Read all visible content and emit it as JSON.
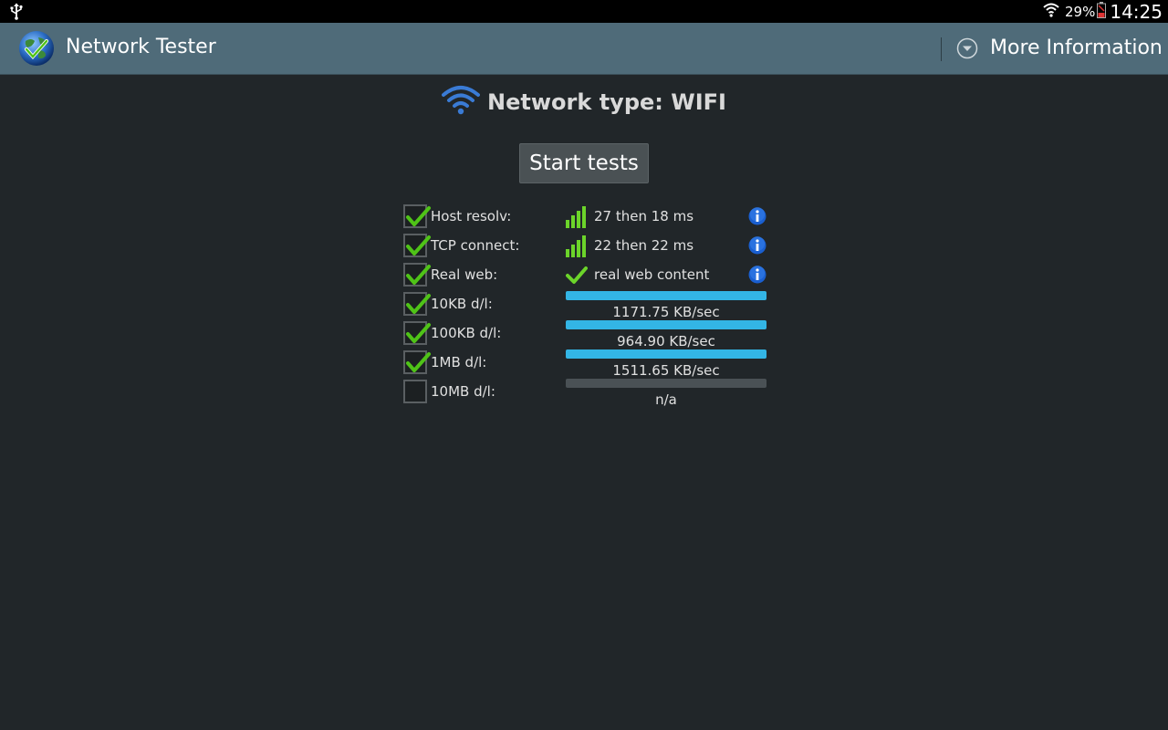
{
  "status_bar": {
    "battery": "29%",
    "time": "14:25",
    "icons": [
      "usb-icon",
      "wifi-icon",
      "battery-icon"
    ]
  },
  "action_bar": {
    "title": "Network Tester",
    "more_info": "More Information",
    "icons": [
      "globe-check-icon",
      "chevron-down-circle-icon"
    ]
  },
  "network": {
    "label": "Network type: WIFI",
    "icon": "wifi-icon",
    "accent": "#3a7bd5"
  },
  "start_button": "Start tests",
  "tests": [
    {
      "label": "Host resolv:",
      "checked": true,
      "result": "27 then 18 ms",
      "icon": "signal-bars-icon",
      "info": true
    },
    {
      "label": "TCP connect:",
      "checked": true,
      "result": "22 then 22 ms",
      "icon": "signal-bars-icon",
      "info": true
    },
    {
      "label": "Real web:",
      "checked": true,
      "result": "real web content",
      "icon": "check-icon",
      "info": true
    }
  ],
  "downloads": [
    {
      "label": "10KB d/l:",
      "checked": true,
      "speed": "1171.75 KB/sec",
      "progress": 1.0
    },
    {
      "label": "100KB d/l:",
      "checked": true,
      "speed": "964.90 KB/sec",
      "progress": 1.0
    },
    {
      "label": "1MB d/l:",
      "checked": true,
      "speed": "1511.65 KB/sec",
      "progress": 1.0
    },
    {
      "label": "10MB d/l:",
      "checked": false,
      "speed": "n/a",
      "progress": 0.0
    }
  ],
  "colors": {
    "background": "#212629",
    "action_bar": "#4f6b79",
    "progress": "#33b5e5",
    "check": "#4fc317",
    "info": "#1a5fd0"
  }
}
